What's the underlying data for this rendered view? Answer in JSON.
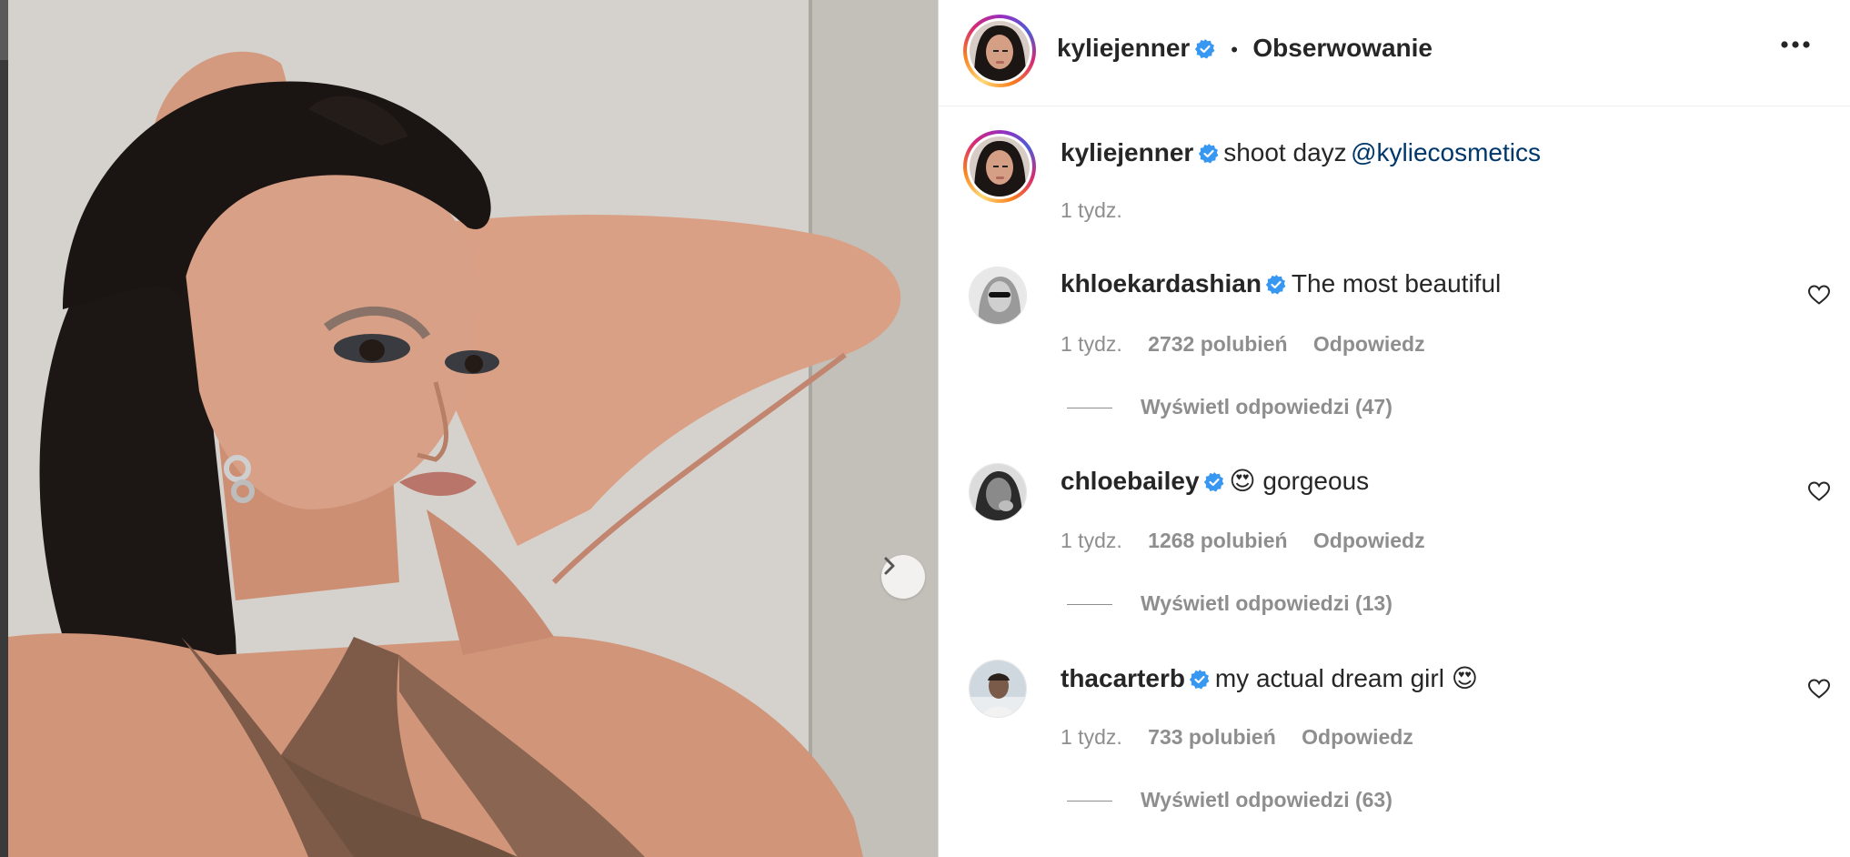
{
  "post": {
    "author": "kyliejenner",
    "follow_label": "Obserwowanie",
    "more_icon": "more-horizontal-icon",
    "caption_author": "kyliejenner",
    "caption_text": "shoot dayz",
    "caption_mention": "@kyliecosmetics",
    "caption_time": "1 tydz."
  },
  "comments": [
    {
      "username": "khloekardashian",
      "text": "The most beautiful",
      "time": "1 tydz.",
      "likes": "2732 polubień",
      "reply": "Odpowiedz",
      "view_replies": "Wyświetl odpowiedzi (47)"
    },
    {
      "username": "chloebailey",
      "text": "😍 gorgeous",
      "time": "1 tydz.",
      "likes": "1268 polubień",
      "reply": "Odpowiedz",
      "view_replies": "Wyświetl odpowiedzi (13)"
    },
    {
      "username": "thacarterb",
      "text": "my actual dream girl 😍",
      "time": "1 tydz.",
      "likes": "733 polubień",
      "reply": "Odpowiedz",
      "view_replies": "Wyświetl odpowiedzi (63)"
    }
  ],
  "colors": {
    "verified": "#3897f0",
    "mention": "#00376b",
    "secondary_text": "#8e8e8e"
  }
}
